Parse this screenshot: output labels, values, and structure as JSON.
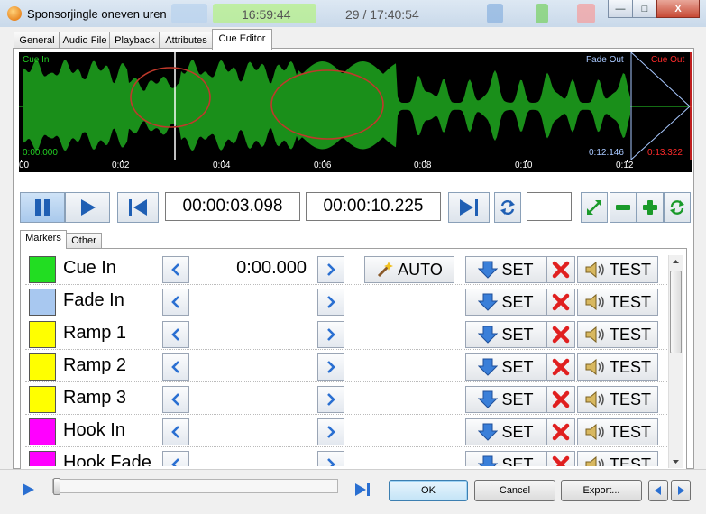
{
  "window": {
    "title": "Sponsorjingle oneven uren",
    "background_text": [
      "16:59:44",
      "29 / 17:40:54"
    ],
    "controls": {
      "minimize": "—",
      "maximize": "□",
      "close": "X"
    }
  },
  "tabs": [
    {
      "label": "General"
    },
    {
      "label": "Audio File"
    },
    {
      "label": "Playback"
    },
    {
      "label": "Attributes"
    },
    {
      "label": "Cue Editor",
      "active": true
    }
  ],
  "waveform": {
    "cue_in_label": "Cue In",
    "cue_in_time": "0:00.000",
    "fade_out_label": "Fade Out",
    "fade_out_time": "0:12.146",
    "cue_out_label": "Cue Out",
    "cue_out_time": "0:13.322",
    "ruler": [
      "00",
      "0:02",
      "0:04",
      "0:06",
      "0:08",
      "0:10",
      "0:12"
    ],
    "colors": {
      "wave": "#1a8f1a",
      "cue_in": "#22cc22",
      "fade_out": "#a8c8ff",
      "cue_out": "#ff2a2a"
    }
  },
  "transport": {
    "position_time": "00:00:03.098",
    "length_time": "00:00:10.225",
    "extra_value": ""
  },
  "subtabs": [
    {
      "label": "Markers",
      "active": true
    },
    {
      "label": "Other"
    }
  ],
  "markers": [
    {
      "name": "Cue In",
      "color": "#22dd22",
      "time": "0:00.000",
      "auto": "AUTO"
    },
    {
      "name": "Fade In",
      "color": "#a8c8f0",
      "time": ""
    },
    {
      "name": "Ramp 1",
      "color": "#ffff00",
      "time": ""
    },
    {
      "name": "Ramp 2",
      "color": "#ffff00",
      "time": ""
    },
    {
      "name": "Ramp 3",
      "color": "#ffff00",
      "time": ""
    },
    {
      "name": "Hook In",
      "color": "#ff00ff",
      "time": ""
    },
    {
      "name": "Hook Fade",
      "color": "#ff00ff",
      "time": ""
    }
  ],
  "row_buttons": {
    "set": "SET",
    "test": "TEST"
  },
  "player": {
    "progress": 0
  },
  "dialog": {
    "ok": "OK",
    "cancel": "Cancel",
    "export": "Export..."
  }
}
